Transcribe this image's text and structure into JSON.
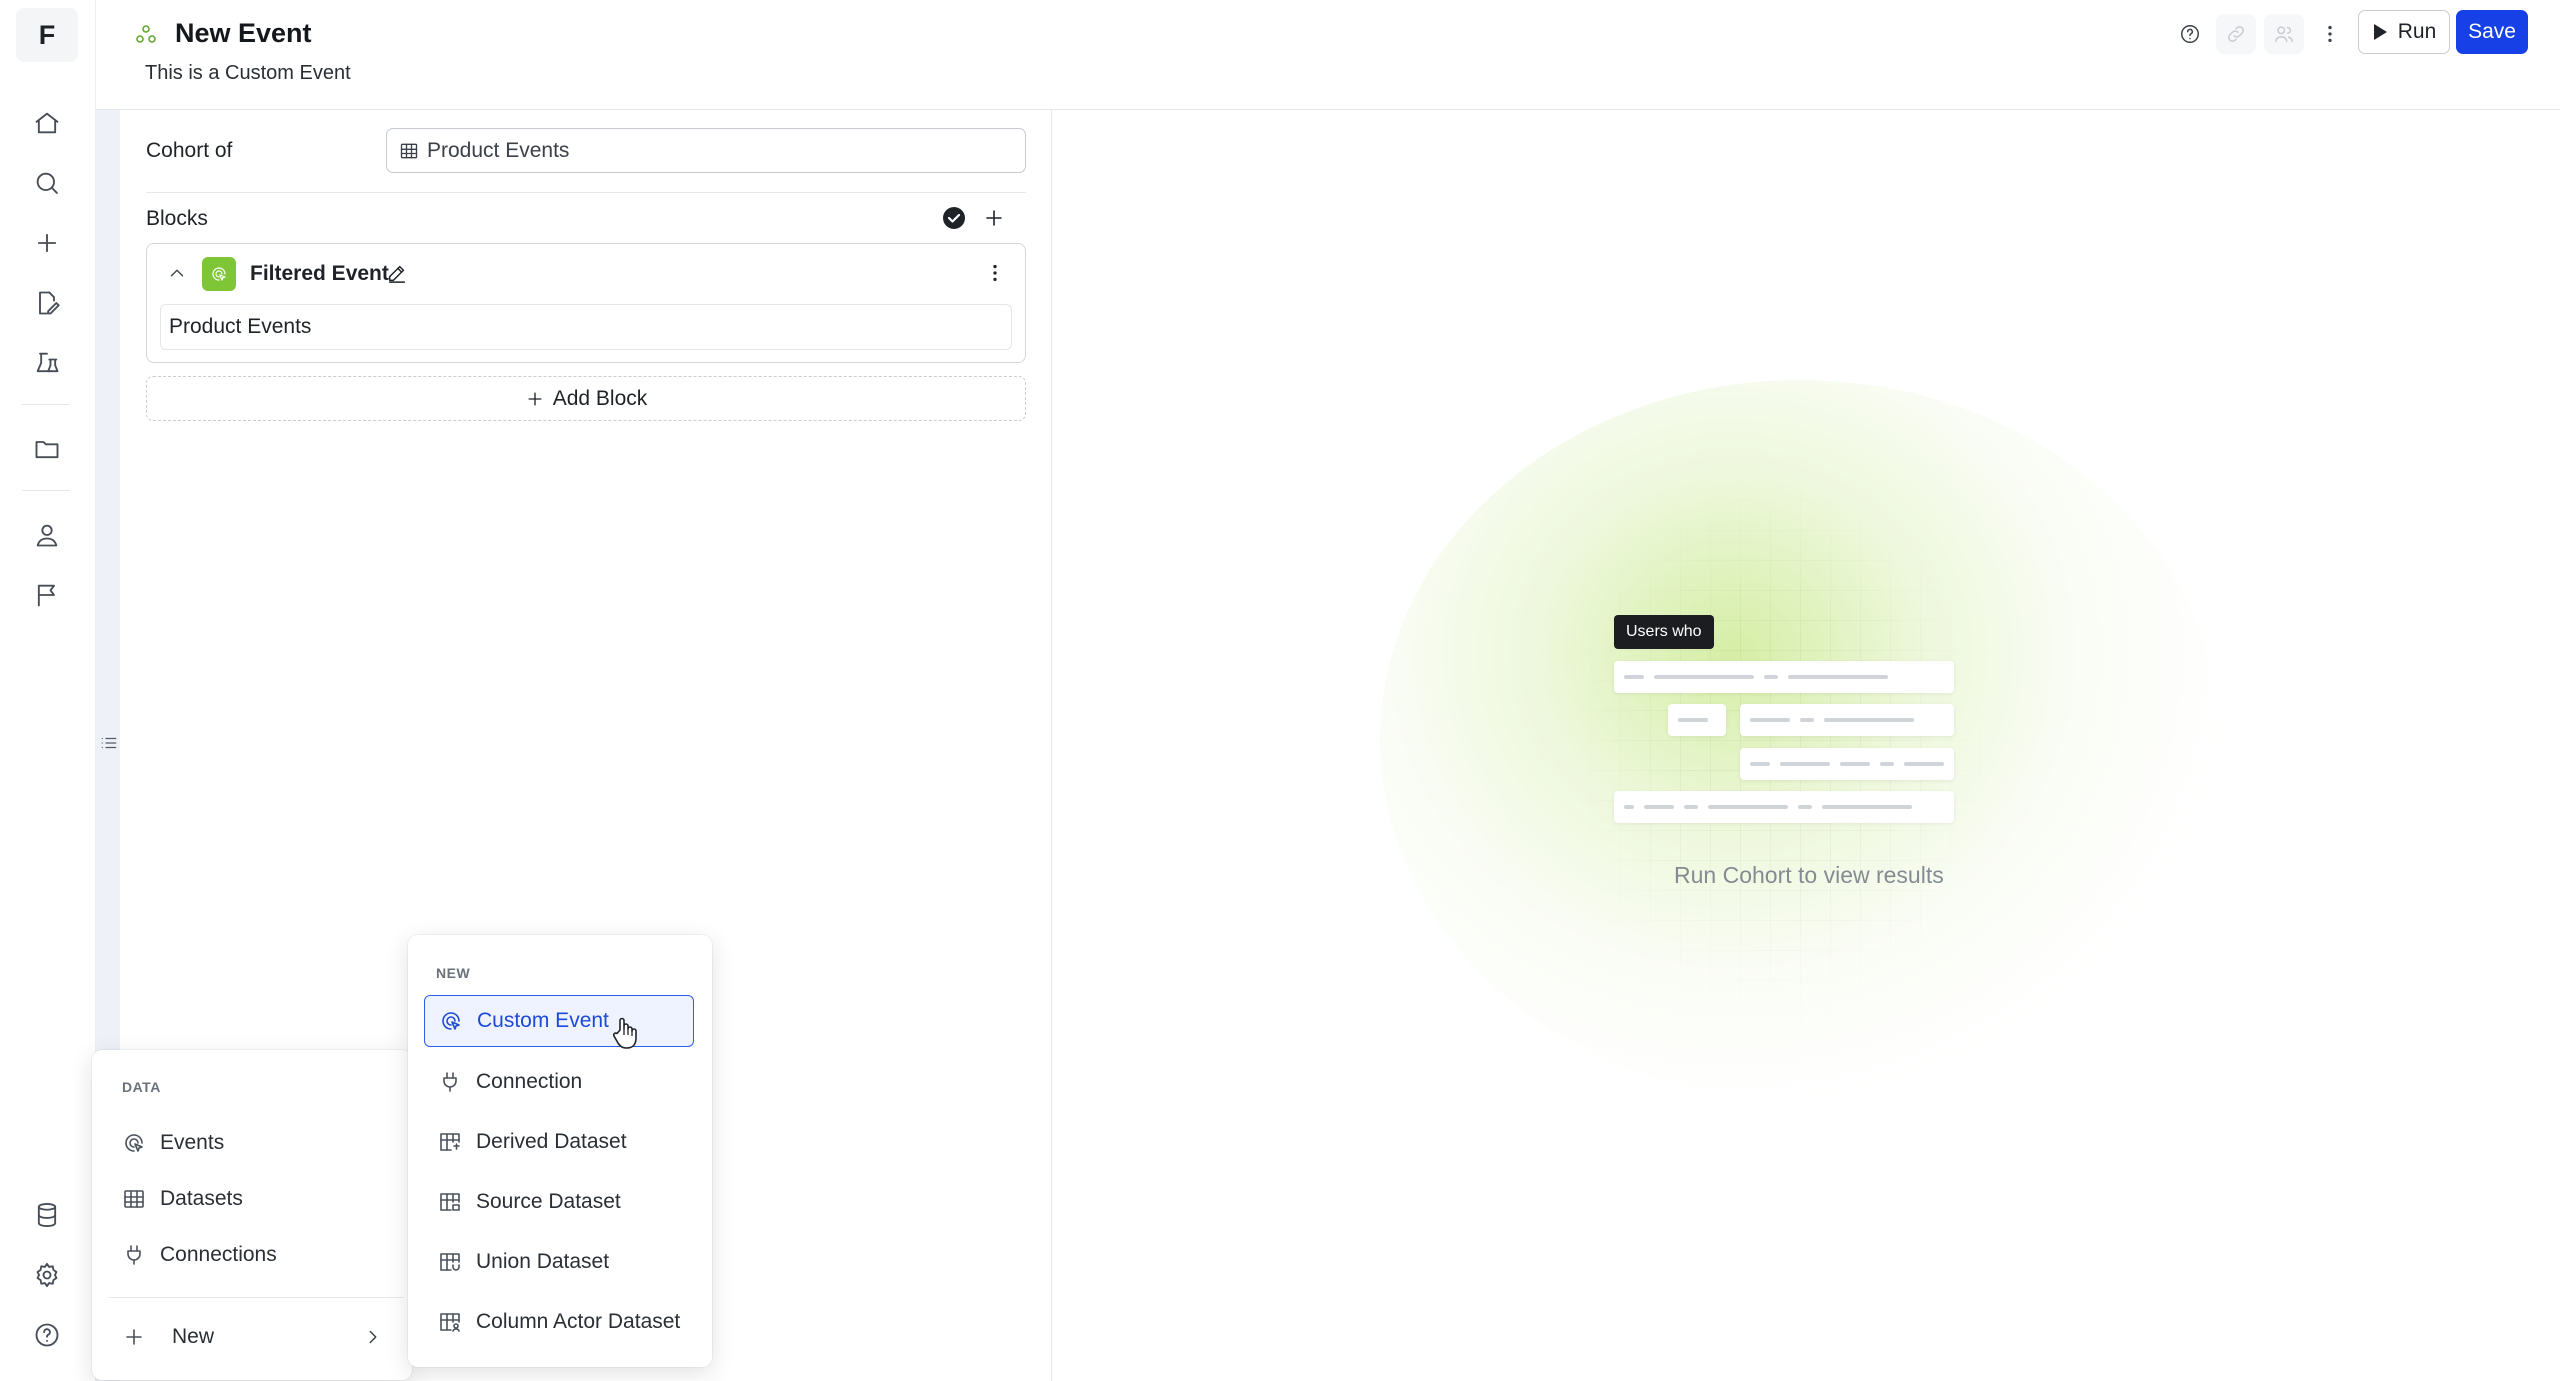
{
  "rail": {
    "logo": "F"
  },
  "header": {
    "title": "New Event",
    "subtitle": "This is a Custom Event",
    "run_label": "Run",
    "save_label": "Save"
  },
  "form": {
    "cohort_label": "Cohort of",
    "cohort_value": "Product Events",
    "blocks_label": "Blocks",
    "block": {
      "title": "Filtered Event",
      "field_value": "Product Events"
    },
    "add_block_label": "Add Block"
  },
  "empty_state": {
    "chip": "Users who",
    "message": "Run Cohort to view results"
  },
  "menu_data": {
    "header": "DATA",
    "items": [
      "Events",
      "Datasets",
      "Connections"
    ],
    "new_label": "New"
  },
  "menu_new": {
    "header": "NEW",
    "items": [
      "Custom Event",
      "Connection",
      "Derived Dataset",
      "Source Dataset",
      "Union Dataset",
      "Column Actor Dataset"
    ],
    "active": "Custom Event"
  },
  "colors": {
    "primary": "#1740e6",
    "accent_green": "#7ec636",
    "active_item": "#2f5ee8"
  }
}
